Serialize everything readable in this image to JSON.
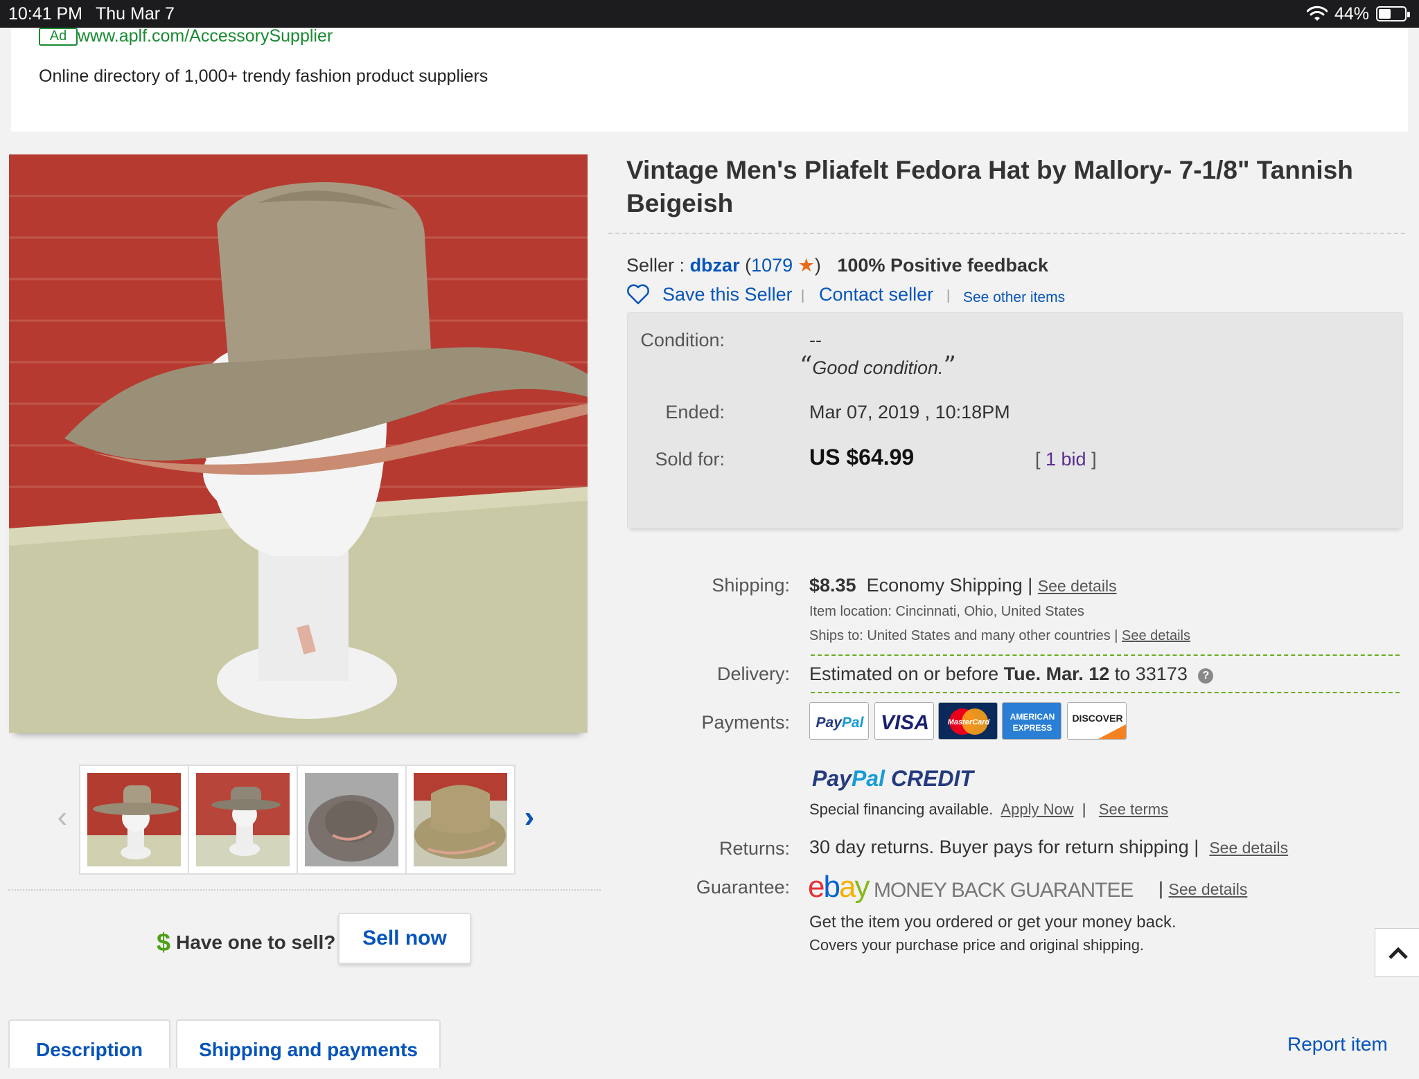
{
  "status_bar": {
    "time": "10:41 PM",
    "date": "Thu Mar 7",
    "battery": "44%",
    "battery_level": 0.44
  },
  "ad": {
    "badge": "Ad",
    "url": "www.aplf.com/AccessorySupplier",
    "description": "Online directory of 1,000+ trendy fashion product suppliers"
  },
  "listing": {
    "title": "Vintage Men's Pliafelt Fedora Hat by Mallory- 7-1/8\" Tannish Beigeish",
    "seller_label": "Seller :",
    "seller_name": "dbzar",
    "feedback_count": "1079",
    "positive_feedback": "100% Positive feedback",
    "save_seller": "Save this Seller",
    "contact_seller": "Contact seller",
    "see_other_items": "See other items",
    "separator": "|"
  },
  "info": {
    "condition_label": "Condition:",
    "condition_value": "--",
    "condition_note": "Good condition.",
    "ended_label": "Ended:",
    "ended_value": "Mar 07, 2019 , 10:18PM",
    "sold_label": "Sold for:",
    "sold_price": "US $64.99",
    "bids": "1 bid"
  },
  "shipping": {
    "label": "Shipping:",
    "cost": "$8.35",
    "method": "Economy Shipping",
    "see_details": "See details",
    "item_location": "Item location:  Cincinnati, Ohio, United States",
    "ships_to": "Ships to:  United States and many other countries",
    "ships_see_details": "See details"
  },
  "delivery": {
    "label": "Delivery:",
    "prefix": "Estimated on or before",
    "date": "Tue. Mar. 12",
    "suffix": "to 33173",
    "help": "?"
  },
  "payments": {
    "label": "Payments:",
    "methods": [
      "PayPal",
      "VISA",
      "MasterCard",
      "AMERICAN EXPRESS",
      "DISCOVER"
    ],
    "paypal_credit": "PayPal CREDIT",
    "financing": "Special financing available.",
    "apply_now": "Apply Now",
    "see_terms": "See terms"
  },
  "returns": {
    "label": "Returns:",
    "text": "30 day returns. Buyer pays for return shipping",
    "see_details": "See details"
  },
  "guarantee": {
    "label": "Guarantee:",
    "logo_ebay": "ebay",
    "logo_text": "MONEY BACK GUARANTEE",
    "see_details": "See details",
    "line1": "Get the item you ordered or get your money back.",
    "line2": "Covers your purchase price and original shipping."
  },
  "sell": {
    "question": "Have one to sell?",
    "dollar": "$",
    "button": "Sell now"
  },
  "tabs": [
    "Description",
    "Shipping and payments"
  ],
  "report_item": "Report item",
  "colors": {
    "link_blue": "#0654ba",
    "ad_green": "#1a8a32",
    "delivery_dash_green": "#6cab20"
  }
}
